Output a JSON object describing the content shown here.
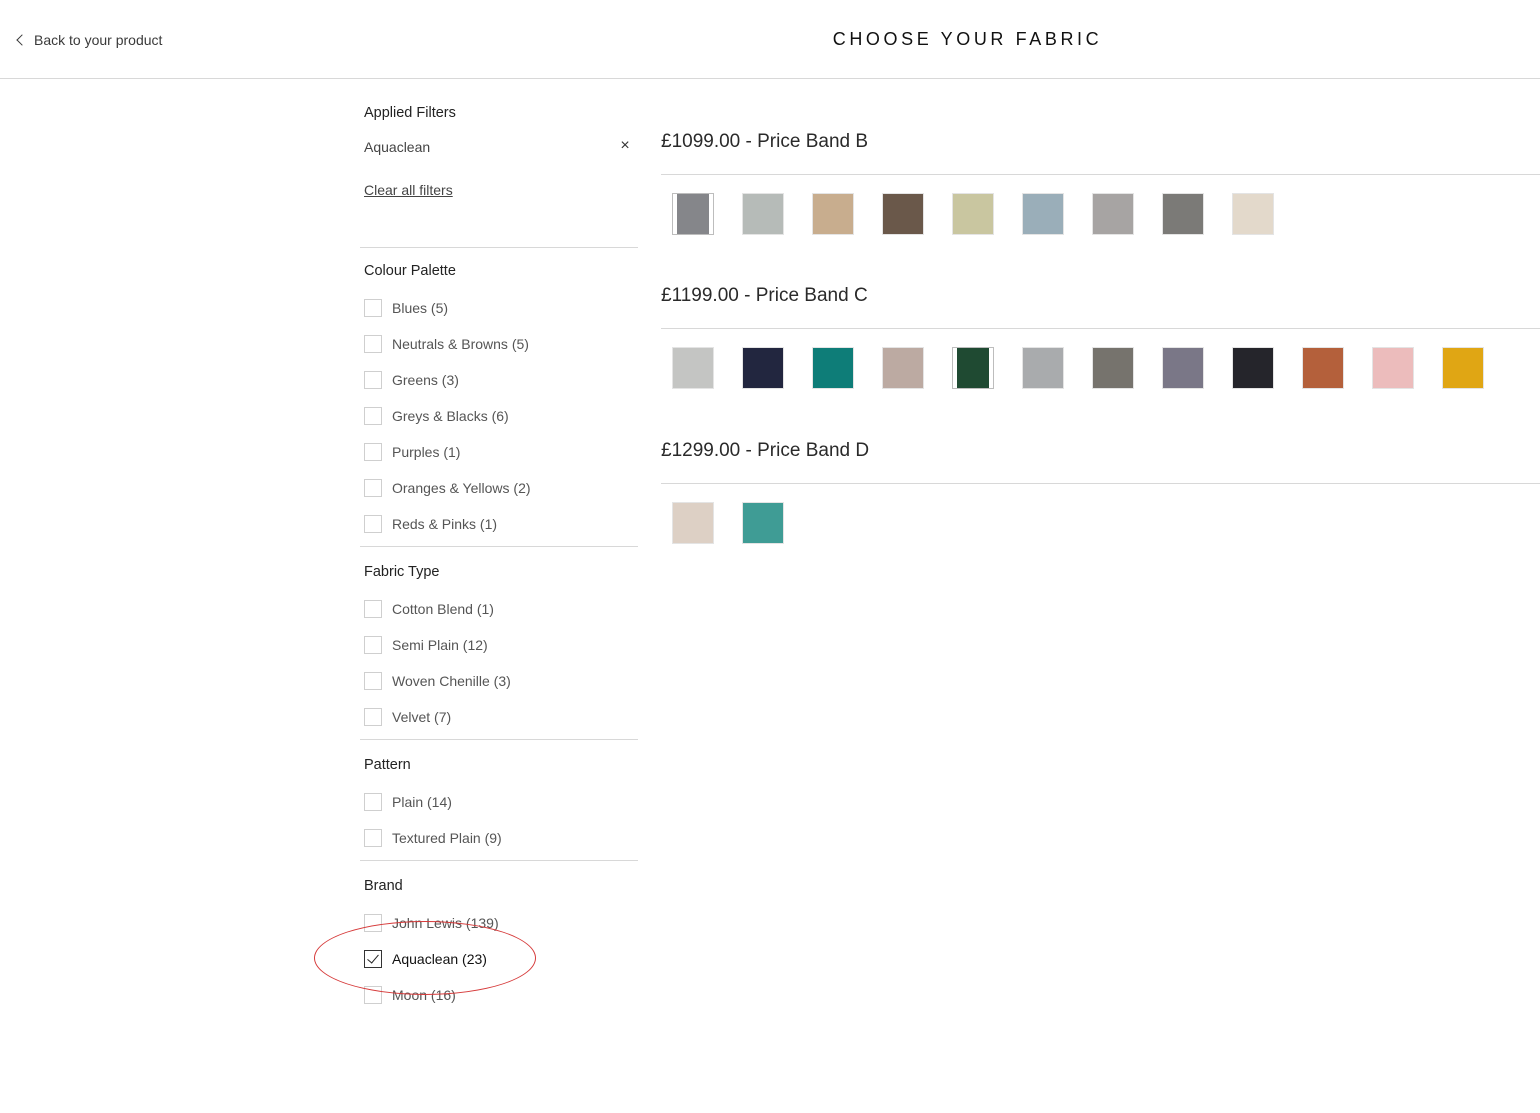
{
  "header": {
    "back_label": "Back to your product",
    "title": "CHOOSE YOUR FABRIC"
  },
  "sidebar": {
    "applied": {
      "title": "Applied Filters",
      "filters": [
        {
          "label": "Aquaclean",
          "remove_icon": "×"
        }
      ],
      "clear_label": "Clear all filters"
    },
    "groups": [
      {
        "title": "Colour Palette",
        "options": [
          {
            "label": "Blues (5)",
            "checked": false
          },
          {
            "label": "Neutrals & Browns (5)",
            "checked": false
          },
          {
            "label": "Greens (3)",
            "checked": false
          },
          {
            "label": "Greys & Blacks (6)",
            "checked": false
          },
          {
            "label": "Purples (1)",
            "checked": false
          },
          {
            "label": "Oranges & Yellows (2)",
            "checked": false
          },
          {
            "label": "Reds & Pinks (1)",
            "checked": false
          }
        ]
      },
      {
        "title": "Fabric Type",
        "options": [
          {
            "label": "Cotton Blend (1)",
            "checked": false
          },
          {
            "label": "Semi Plain (12)",
            "checked": false
          },
          {
            "label": "Woven Chenille (3)",
            "checked": false
          },
          {
            "label": "Velvet (7)",
            "checked": false
          }
        ]
      },
      {
        "title": "Pattern",
        "options": [
          {
            "label": "Plain (14)",
            "checked": false
          },
          {
            "label": "Textured Plain (9)",
            "checked": false
          }
        ]
      },
      {
        "title": "Brand",
        "options": [
          {
            "label": "John Lewis (139)",
            "checked": false
          },
          {
            "label": "Aquaclean (23)",
            "checked": true
          },
          {
            "label": "Moon (16)",
            "checked": false
          }
        ]
      }
    ]
  },
  "annotation": {
    "color": "#d63a3a"
  },
  "bands": [
    {
      "title": "£1099.00 - Price Band B",
      "swatches": [
        {
          "color": "#85868a",
          "selected": true
        },
        {
          "color": "#b6bbb8",
          "selected": false
        },
        {
          "color": "#c8ad8e",
          "selected": false
        },
        {
          "color": "#6a584a",
          "selected": false
        },
        {
          "color": "#c9c6a0",
          "selected": false
        },
        {
          "color": "#9aaeb9",
          "selected": false
        },
        {
          "color": "#a7a4a3",
          "selected": false
        },
        {
          "color": "#7b7a77",
          "selected": false
        },
        {
          "color": "#e3d9cb",
          "selected": false
        }
      ]
    },
    {
      "title": "£1199.00 - Price Band C",
      "swatches": [
        {
          "color": "#c4c5c3",
          "selected": false
        },
        {
          "color": "#22263f",
          "selected": false
        },
        {
          "color": "#0e7d78",
          "selected": false
        },
        {
          "color": "#bcaaa2",
          "selected": false
        },
        {
          "color": "#1f4a32",
          "selected": true
        },
        {
          "color": "#a9abad",
          "selected": false
        },
        {
          "color": "#76736d",
          "selected": false
        },
        {
          "color": "#7a7787",
          "selected": false
        },
        {
          "color": "#25252b",
          "selected": false
        },
        {
          "color": "#b4603b",
          "selected": false
        },
        {
          "color": "#ecbcbc",
          "selected": false
        },
        {
          "color": "#e0a614",
          "selected": false
        }
      ]
    },
    {
      "title": "£1299.00 - Price Band D",
      "swatches": [
        {
          "color": "#ddd0c5",
          "selected": false
        },
        {
          "color": "#3f9c95",
          "selected": false
        }
      ]
    }
  ]
}
